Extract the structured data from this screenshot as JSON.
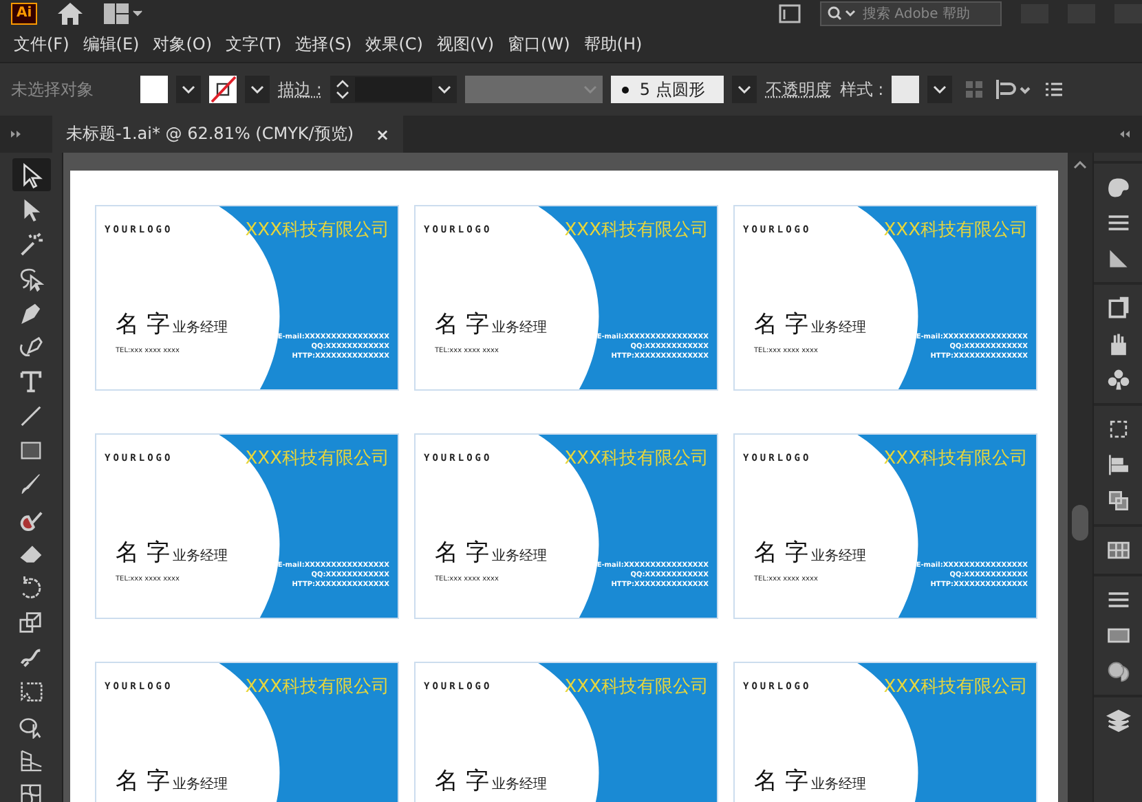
{
  "app": {
    "logo": "Ai"
  },
  "search": {
    "placeholder": "搜索 Adobe 帮助"
  },
  "menu": [
    "文件(F)",
    "编辑(E)",
    "对象(O)",
    "文字(T)",
    "选择(S)",
    "效果(C)",
    "视图(V)",
    "窗口(W)",
    "帮助(H)"
  ],
  "control_bar": {
    "selection": "未选择对象",
    "stroke_label": "描边 :",
    "brush": "5 点圆形",
    "opacity_label": "不透明度",
    "style_label": "样式 :"
  },
  "tab": {
    "title": "未标题-1.ai* @ 62.81% (CMYK/预览)",
    "close": "×"
  },
  "tools": [
    {
      "kind": "selection",
      "selected": true
    },
    {
      "kind": "direct",
      "selected": false
    },
    {
      "kind": "wand",
      "selected": false
    },
    {
      "kind": "lasso",
      "selected": false
    },
    {
      "kind": "pen",
      "selected": false
    },
    {
      "kind": "curvature",
      "selected": false
    },
    {
      "kind": "type",
      "selected": false
    },
    {
      "kind": "line",
      "selected": false
    },
    {
      "kind": "rect",
      "selected": false
    },
    {
      "kind": "brush",
      "selected": false
    },
    {
      "kind": "shaper",
      "selected": false
    },
    {
      "kind": "eraser",
      "selected": false
    },
    {
      "kind": "rotate",
      "selected": false
    },
    {
      "kind": "scale",
      "selected": false
    },
    {
      "kind": "warp",
      "selected": false
    },
    {
      "kind": "transform",
      "selected": false
    },
    {
      "kind": "builder",
      "selected": false
    },
    {
      "kind": "perspective",
      "selected": false
    },
    {
      "kind": "mesh",
      "selected": false
    }
  ],
  "cards": [
    {
      "logo": "YOURLOGO",
      "company": "XXX科技有限公司",
      "name": "名 字",
      "title": "业务经理",
      "tel": "TEL:xxx xxxx xxxx",
      "contacts": [
        "E-mail:XXXXXXXXXXXXXXXX",
        "QQ:XXXXXXXXXXXX",
        "HTTP:XXXXXXXXXXXXXX"
      ]
    },
    {
      "logo": "YOURLOGO",
      "company": "XXX科技有限公司",
      "name": "名 字",
      "title": "业务经理",
      "tel": "TEL:xxx xxxx xxxx",
      "contacts": [
        "E-mail:XXXXXXXXXXXXXXXX",
        "QQ:XXXXXXXXXXXX",
        "HTTP:XXXXXXXXXXXXXX"
      ]
    },
    {
      "logo": "YOURLOGO",
      "company": "XXX科技有限公司",
      "name": "名 字",
      "title": "业务经理",
      "tel": "TEL:xxx xxxx xxxx",
      "contacts": [
        "E-mail:XXXXXXXXXXXXXXXX",
        "QQ:XXXXXXXXXXXX",
        "HTTP:XXXXXXXXXXXXXX"
      ]
    },
    {
      "logo": "YOURLOGO",
      "company": "XXX科技有限公司",
      "name": "名 字",
      "title": "业务经理",
      "tel": "TEL:xxx xxxx xxxx",
      "contacts": [
        "E-mail:XXXXXXXXXXXXXXXX",
        "QQ:XXXXXXXXXXXX",
        "HTTP:XXXXXXXXXXXXXX"
      ]
    },
    {
      "logo": "YOURLOGO",
      "company": "XXX科技有限公司",
      "name": "名 字",
      "title": "业务经理",
      "tel": "TEL:xxx xxxx xxxx",
      "contacts": [
        "E-mail:XXXXXXXXXXXXXXXX",
        "QQ:XXXXXXXXXXXX",
        "HTTP:XXXXXXXXXXXXXX"
      ]
    },
    {
      "logo": "YOURLOGO",
      "company": "XXX科技有限公司",
      "name": "名 字",
      "title": "业务经理",
      "tel": "TEL:xxx xxxx xxxx",
      "contacts": [
        "E-mail:XXXXXXXXXXXXXXXX",
        "QQ:XXXXXXXXXXXX",
        "HTTP:XXXXXXXXXXXXXX"
      ]
    },
    {
      "logo": "YOURLOGO",
      "company": "XXX科技有限公司",
      "name": "名 字",
      "title": "业务经理"
    },
    {
      "logo": "YOURLOGO",
      "company": "XXX科技有限公司",
      "name": "名 字",
      "title": "业务经理"
    },
    {
      "logo": "YOURLOGO",
      "company": "XXX科技有限公司",
      "name": "名 字",
      "title": "业务经理"
    }
  ]
}
